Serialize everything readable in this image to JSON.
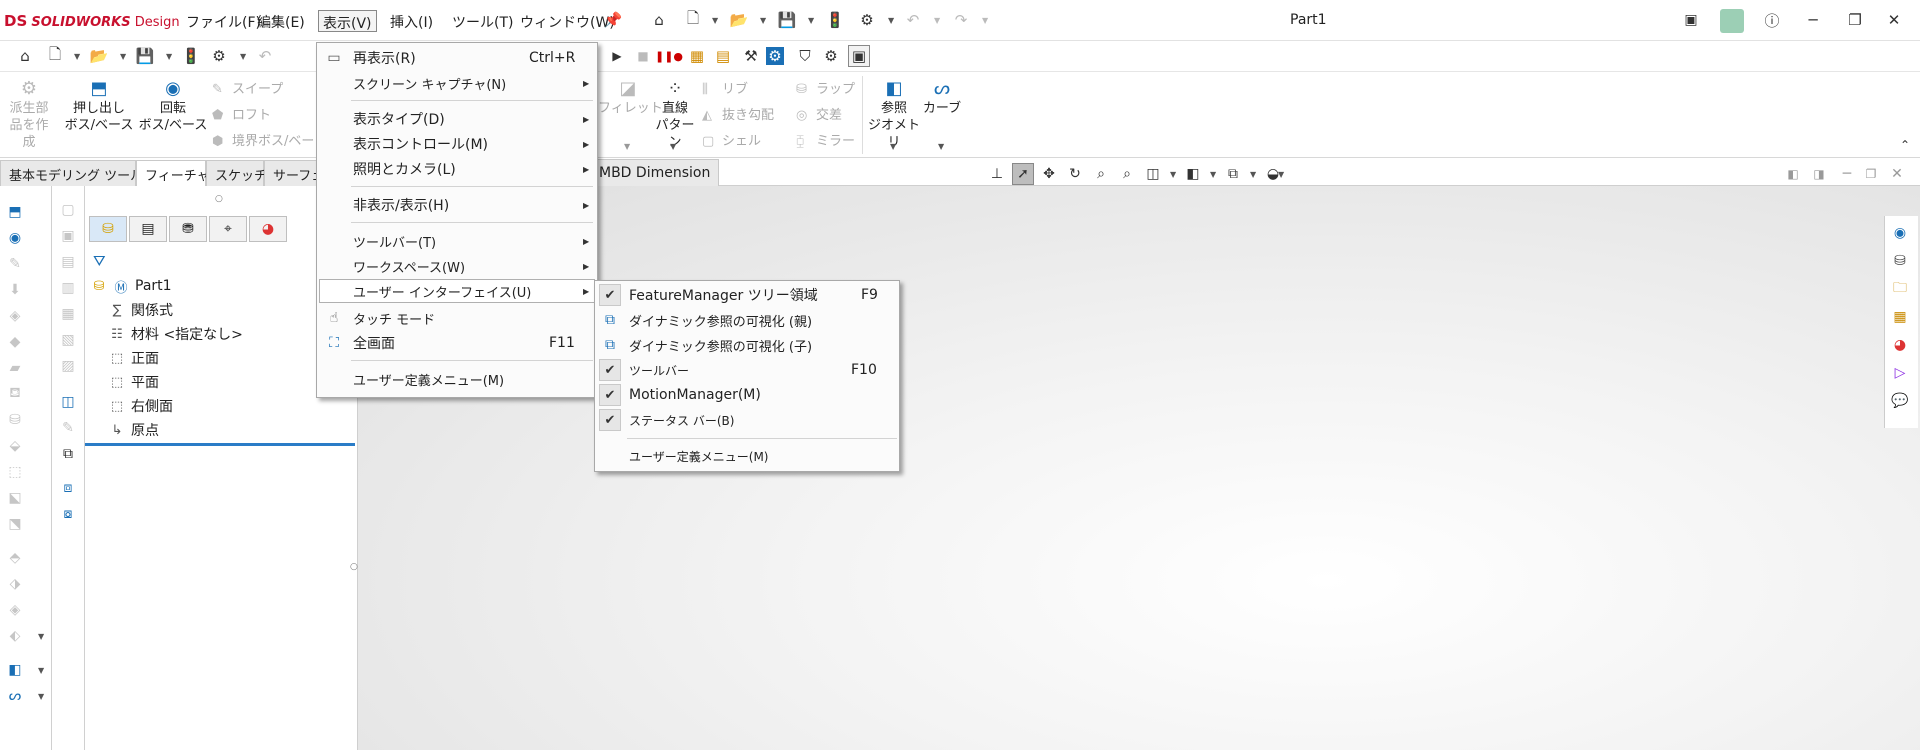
{
  "app": {
    "logo_ds": "DS",
    "logo_solidworks": "SOLIDWORKS",
    "logo_design": "Design",
    "document_title": "Part1"
  },
  "menubar": [
    {
      "label": "ファイル(F)"
    },
    {
      "label": "編集(E)"
    },
    {
      "label": "表示(V)",
      "active": true
    },
    {
      "label": "挿入(I)"
    },
    {
      "label": "ツール(T)"
    },
    {
      "label": "ウィンドウ(W)"
    }
  ],
  "ribbon": {
    "derived_part": "派生部\n品を作\n成",
    "extrude": "押し出し\nボス/ベース",
    "revolve": "回転\nボス/ベース",
    "sweep": "スイープ",
    "loft": "ロフト",
    "boundary": "境界ボス/ベー",
    "fillet": "フィレット",
    "linear_pattern": "直線\nパターン",
    "rib": "リブ",
    "draft": "抜き勾配",
    "shell": "シェル",
    "wrap": "ラップ",
    "intersect": "交差",
    "mirror": "ミラー",
    "ref_geometry": "参照\nジオメトリ",
    "curves": "カーブ"
  },
  "command_tabs": [
    {
      "label": "基本モデリング ツール"
    },
    {
      "label": "フィーチャー",
      "active": true
    },
    {
      "label": "スケッチ"
    },
    {
      "label": "サーフェス"
    }
  ],
  "mbd_tab": "MBD Dimension",
  "feature_tree": {
    "root": "Part1",
    "items": [
      {
        "label": "関係式",
        "icon": "sigma-icon"
      },
      {
        "label": "材料 <指定なし>",
        "icon": "material-icon"
      },
      {
        "label": "正面",
        "icon": "plane-icon"
      },
      {
        "label": "平面",
        "icon": "plane-icon"
      },
      {
        "label": "右側面",
        "icon": "plane-icon"
      },
      {
        "label": "原点",
        "icon": "origin-icon"
      }
    ]
  },
  "view_menu": {
    "items": [
      {
        "label": "再表示(R)",
        "shortcut": "Ctrl+R",
        "icon": "redraw-icon"
      },
      {
        "label": "スクリーン キャプチャ(N)",
        "submenu": true
      },
      {
        "label": "表示タイプ(D)",
        "submenu": true
      },
      {
        "label": "表示コントロール(M)",
        "submenu": true
      },
      {
        "label": "照明とカメラ(L)",
        "submenu": true
      },
      {
        "label": "非表示/表示(H)",
        "submenu": true
      },
      {
        "label": "ツールバー(T)",
        "submenu": true
      },
      {
        "label": "ワークスペース(W)",
        "submenu": true
      },
      {
        "label": "ユーザー インターフェイス(U)",
        "submenu": true,
        "highlighted": true
      },
      {
        "label": "タッチ モード",
        "icon": "touch-icon"
      },
      {
        "label": "全画面",
        "shortcut": "F11",
        "icon": "fullscreen-icon"
      },
      {
        "label": "ユーザー定義メニュー(M)"
      }
    ]
  },
  "ui_submenu": {
    "items": [
      {
        "label": "FeatureManager ツリー領域",
        "shortcut": "F9",
        "checked": true
      },
      {
        "label": "ダイナミック参照の可視化 (親)",
        "icon": "dynamic-parent-icon"
      },
      {
        "label": "ダイナミック参照の可視化 (子)",
        "icon": "dynamic-child-icon"
      },
      {
        "label": "ツールバー",
        "shortcut": "F10",
        "checked": true
      },
      {
        "label": "MotionManager(M)",
        "checked": true
      },
      {
        "label": "ステータス バー(B)",
        "checked": true
      },
      {
        "label": "ユーザー定義メニュー(M)"
      }
    ]
  }
}
